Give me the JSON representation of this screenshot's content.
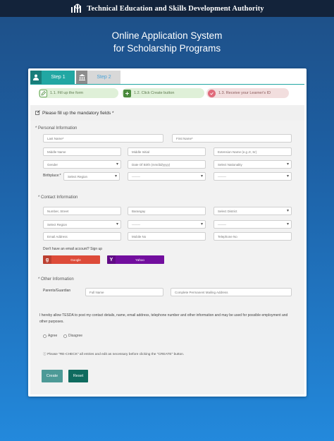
{
  "header": {
    "org_name": "Technical Education and Skills Development Authority",
    "title_line1": "Online Application System",
    "title_line2": "for Scholarship Programs"
  },
  "tabs": [
    {
      "label": "Step 1",
      "icon": "user-icon",
      "active": true
    },
    {
      "label": "Step 2",
      "icon": "bank-icon",
      "active": false
    }
  ],
  "steps": [
    {
      "label": "1.1. Fill up the form",
      "icon": "edit-icon",
      "status": "done"
    },
    {
      "label": "1.2. Click Create button",
      "icon": "plus-square-icon",
      "status": "done"
    },
    {
      "label": "1.3. Receive your Learner's ID",
      "icon": "check-circle-icon",
      "status": "pending"
    }
  ],
  "notice": "Please fill up the mandatory fields *",
  "personal": {
    "heading": "* Personal Information",
    "last_name": "Last Name*",
    "first_name": "First Name*",
    "middle_name": "Middle Name",
    "middle_initial": "Middle Initial",
    "extension": "Extension Name (e.g Jr, Sr)",
    "gender": "Gender",
    "dob": "Date Of Birth (mm/dd/yyyy)",
    "nationality": "Select Nationality",
    "birthplace_label": "Birthplace:*",
    "birth_region": "Select Region",
    "birth_province": "--------",
    "birth_city": "--------"
  },
  "contact": {
    "heading": "* Contact Information",
    "street": "Number, Street",
    "barangay": "Barangay",
    "district": "Select District",
    "region": "Select Region",
    "province": "--------",
    "city": "--------",
    "email": "Email Address",
    "mobile": "Mobile No",
    "telephone": "Telephone No",
    "no_email_text": "Don't have an email account? Sign up",
    "google_label": "Google",
    "yahoo_label": "Yahoo"
  },
  "other": {
    "heading": "* Other Information",
    "guardian_label": "Parents/Guardian",
    "full_name": "Full Name",
    "mailing_address": "Complete Permanent Mailing Address"
  },
  "consent": {
    "text": "I hereby allow TESDA to post my contact details, name, email address, telephone number and other information and may be used for possible employment and other purposes.",
    "agree": "Agree",
    "disagree": "Disagree",
    "recheck": "Please \"RE-CHECK\" all entries and edit as necessary before clicking the \"CREATE\" button."
  },
  "buttons": {
    "create": "Create",
    "reset": "Reset"
  },
  "colors": {
    "teal": "#21a7a3",
    "header_bg": "#13233a",
    "google": "#dd4b39",
    "yahoo": "#720e9e",
    "reset": "#0f6b5f"
  }
}
